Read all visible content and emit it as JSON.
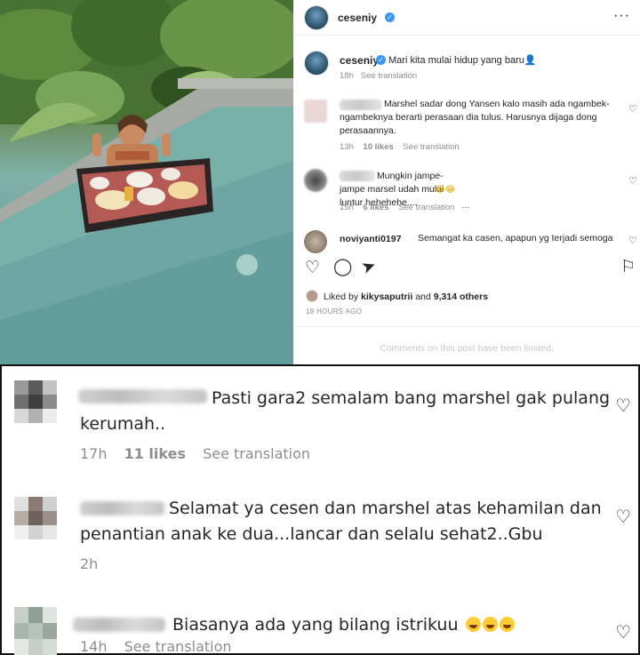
{
  "post": {
    "username": "ceseniy",
    "caption": "Mari kita mulai hidup yang baru👤",
    "caption_time": "18h",
    "see_translation": "See translation",
    "liked_by_prefix": "Liked by",
    "liked_by_user": "kikysaputrii",
    "liked_by_suffix": "and",
    "liked_count": "9,314 others",
    "time_ago": "18 HOURS AGO",
    "comments_limited": "Comments on this post have been limited."
  },
  "comments_small": [
    {
      "text": "Marshel sadar dong Yansen kalo masih ada ngambek-ngambeknya berarti perasaan dia tulus. Harusnya dijaga dong perasaannya.",
      "time": "13h",
      "likes": "10 likes",
      "translate": "See translation"
    },
    {
      "text": "Mungkin jampe-jampe marsel udah mulai luntur hehehehe....",
      "time": "15h",
      "likes": "6 likes",
      "translate": "See translation"
    },
    {
      "username": "noviyanti0197",
      "text": "Semangat ka casen, apapun yg terjadi semoga"
    }
  ],
  "comments_zoom": [
    {
      "text": "Pasti gara2 semalam bang marshel gak pulang kerumah..",
      "time": "17h",
      "likes": "11 likes",
      "translate": "See translation"
    },
    {
      "text": "Selamat ya cesen dan marshel atas kehamilan dan penantian anak ke dua...lancar dan selalu sehat2..Gbu",
      "time": "2h"
    },
    {
      "text": "Biasanya ada yang bilang istrikuu",
      "time": "14h",
      "translate": "See translation"
    }
  ],
  "icons": {
    "heart": "heart-icon",
    "comment": "comment-icon",
    "share": "share-icon",
    "save": "bookmark-icon",
    "verified": "verified-badge-icon",
    "more": "more-options-icon"
  },
  "colors": {
    "verified": "#3897f0",
    "meta_grey": "#8e8e8e",
    "text": "#262626"
  }
}
